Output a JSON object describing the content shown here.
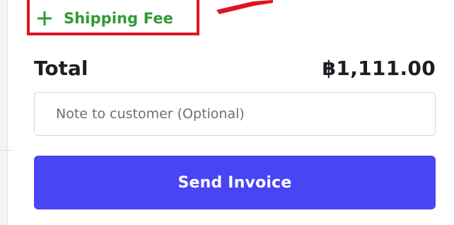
{
  "shipping": {
    "label": "Shipping Fee",
    "icon": "plus-icon",
    "color": "#2f9a35"
  },
  "total": {
    "label": "Total",
    "value": "฿1,111.00"
  },
  "note": {
    "placeholder": "Note to customer (Optional)",
    "value": ""
  },
  "send_button": {
    "label": "Send Invoice",
    "color": "#4845f5"
  },
  "annotation": {
    "highlight_color": "#e0141e"
  }
}
